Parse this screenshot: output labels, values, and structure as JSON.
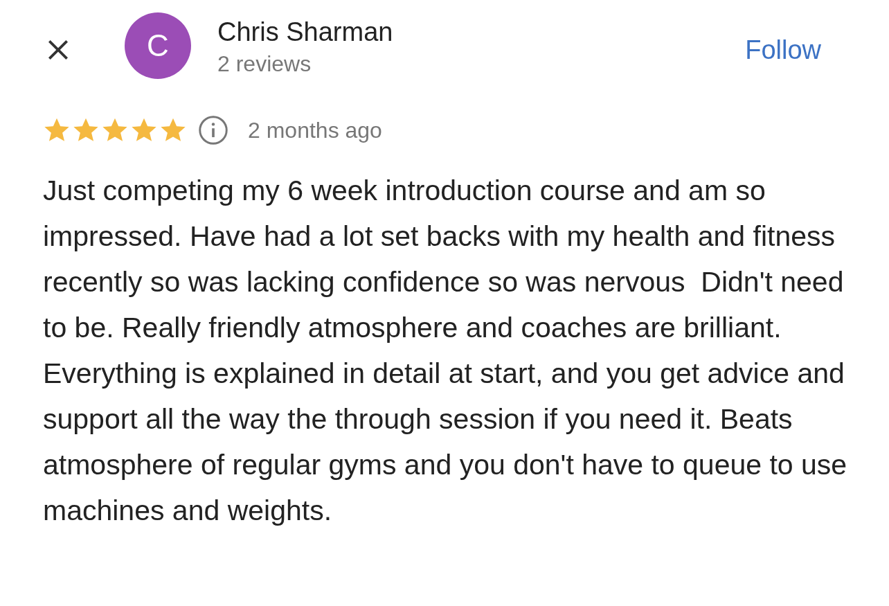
{
  "reviewer": {
    "initial": "C",
    "name": "Chris Sharman",
    "reviews": "2 reviews"
  },
  "follow_button": "Follow",
  "rating": {
    "stars": 5,
    "time": "2 months ago"
  },
  "review_text": "Just competing my 6 week introduction course and am so impressed. Have had a lot set backs with my health and fitness recently so was lacking confidence so was nervous  Didn't need to be. Really friendly atmosphere and coaches are brilliant. Everything is explained in detail at start, and you get advice and support all the way the through session if you need it. Beats atmosphere of regular gyms and you don't have to queue to use machines and weights."
}
